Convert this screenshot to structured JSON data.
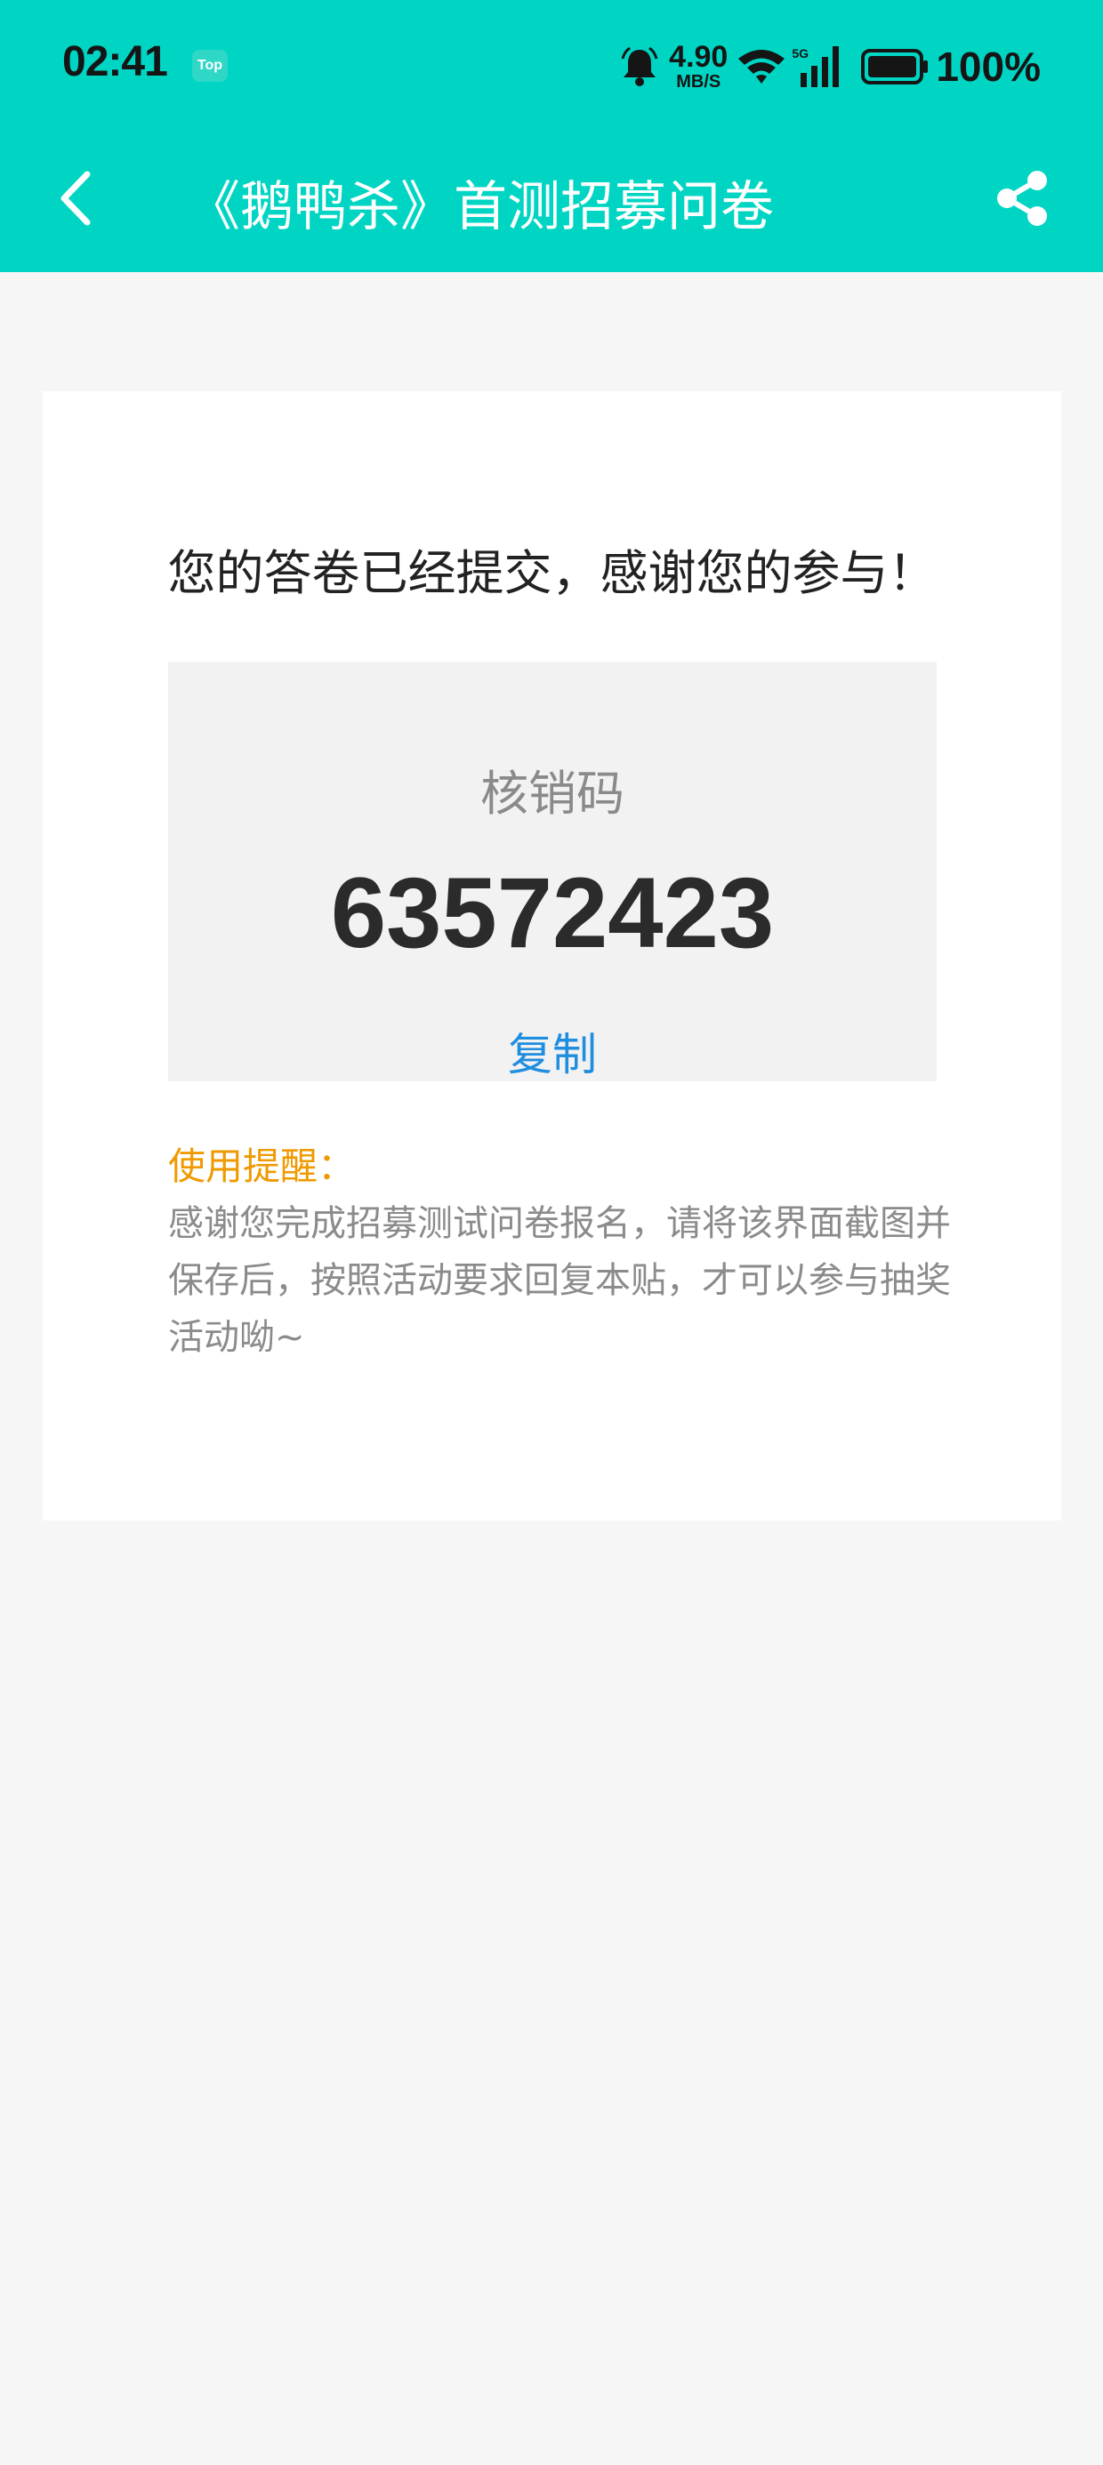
{
  "status_bar": {
    "time": "02:41",
    "top_badge": "Top",
    "speed_value": "4.90",
    "speed_unit": "MB/S",
    "network_type": "5G",
    "battery": "100%"
  },
  "nav": {
    "title": "《鹅鸭杀》首测招募问卷"
  },
  "card": {
    "message": "您的答卷已经提交，感谢您的参与！",
    "code_label": "核销码",
    "code_value": "63572423",
    "copy_label": "复制",
    "reminder_label": "使用提醒：",
    "reminder_text": "感谢您完成招募测试问卷报名，请将该界面截图并保存后，按照活动要求回复本贴，才可以参与抽奖活动呦~"
  },
  "colors": {
    "header_bg": "#00d5c3",
    "page_bg": "#f6f6f6",
    "accent_link": "#1f8de0",
    "reminder_orange": "#ef9a00"
  },
  "icons": {
    "bell": "bell-icon",
    "wifi": "wifi-icon",
    "signal": "signal-icon",
    "battery": "battery-icon",
    "back": "back-arrow-icon",
    "share": "share-icon"
  }
}
